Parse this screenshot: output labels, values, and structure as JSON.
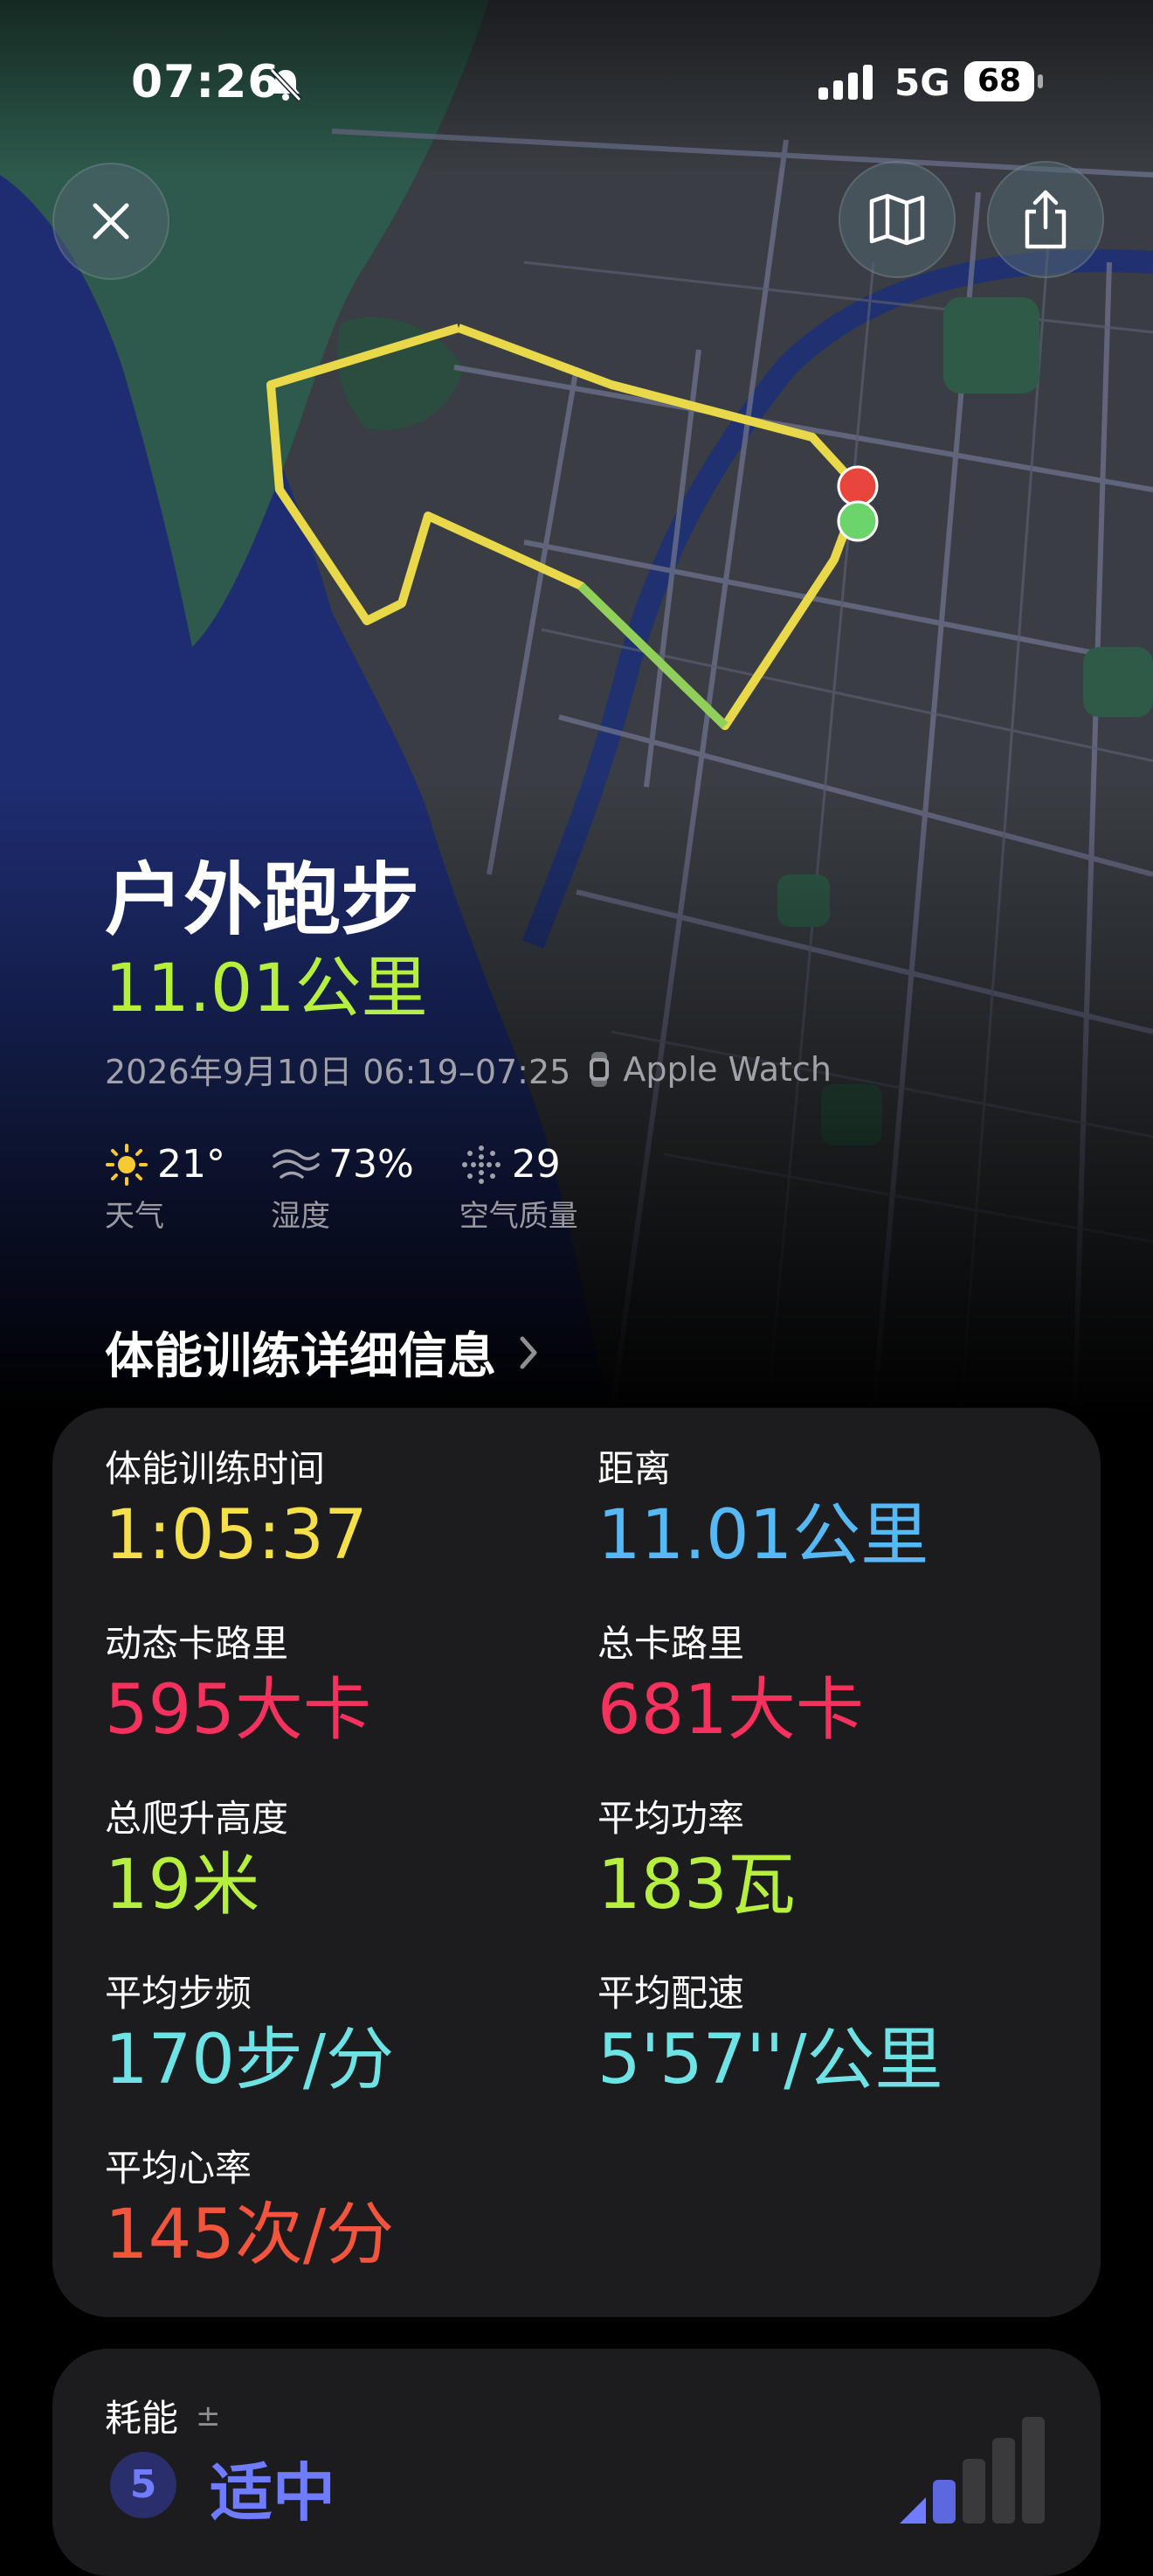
{
  "status_bar": {
    "time": "07:26",
    "network": "5G",
    "battery": "68"
  },
  "icons": {
    "close": "close-icon",
    "map": "map-icon",
    "share": "share-icon",
    "sun": "sun-icon",
    "humidity": "humidity-icon",
    "air_quality": "air-quality-icon",
    "watch": "watch-icon",
    "chevron": "chevron-right-icon"
  },
  "workout": {
    "title": "户外跑步",
    "distance": "11.01公里",
    "date_time": "2026年9月10日 06:19–07:25",
    "device": "Apple Watch"
  },
  "conditions": {
    "weather_value": "21°",
    "weather_label": "天气",
    "humidity_value": "73%",
    "humidity_label": "湿度",
    "aqi_value": "29",
    "aqi_label": "空气质量"
  },
  "details_header": "体能训练详细信息",
  "metrics": {
    "workout_time_label": "体能训练时间",
    "workout_time_value": "1:05:37",
    "distance_label": "距离",
    "distance_value": "11.01公里",
    "active_cal_label": "动态卡路里",
    "active_cal_value": "595大卡",
    "total_cal_label": "总卡路里",
    "total_cal_value": "681大卡",
    "elevation_label": "总爬升高度",
    "elevation_value": "19米",
    "avg_power_label": "平均功率",
    "avg_power_value": "183瓦",
    "avg_cadence_label": "平均步频",
    "avg_cadence_value": "170步/分",
    "avg_pace_label": "平均配速",
    "avg_pace_value": "5'57''/公里",
    "avg_hr_label": "平均心率",
    "avg_hr_value": "145次/分"
  },
  "effort": {
    "label": "耗能",
    "adjust": "±",
    "score": "5",
    "level": "适中"
  },
  "colors": {
    "green": "#b6ef3e",
    "yellow": "#f5e04a",
    "blue": "#56b8f5",
    "red": "#f5325e",
    "cyan": "#6ee3e6",
    "orange": "#f2553c",
    "indigo": "#6f7cff"
  }
}
